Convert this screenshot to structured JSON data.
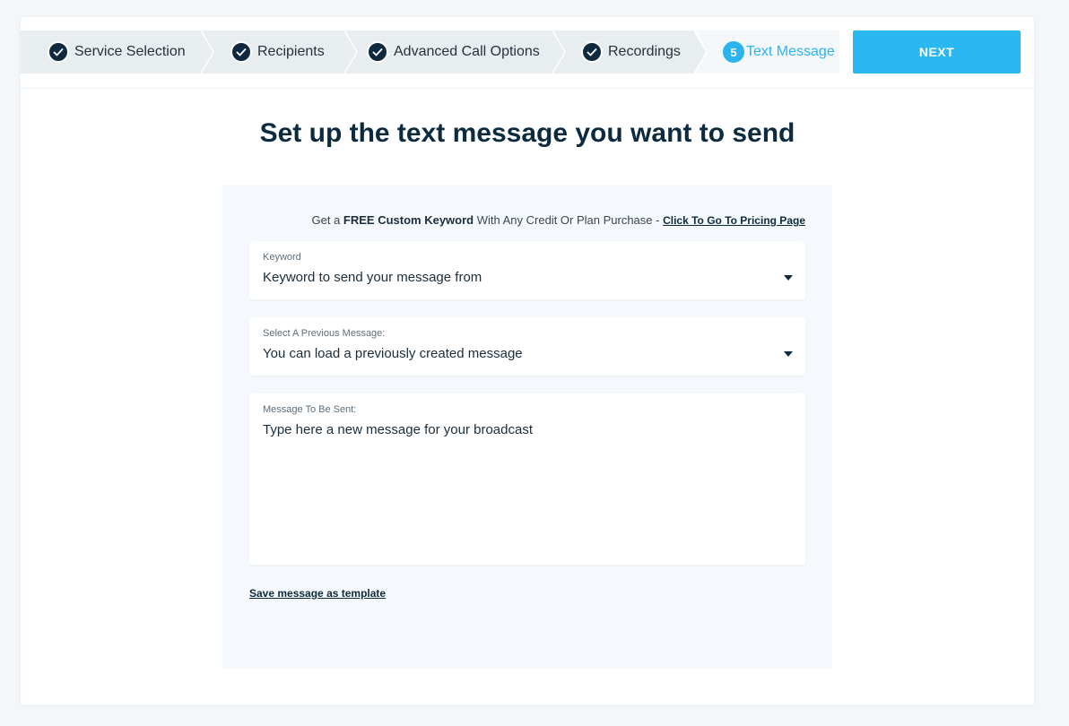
{
  "steps": [
    {
      "label": "Service Selection",
      "status": "done"
    },
    {
      "label": "Recipients",
      "status": "done"
    },
    {
      "label": "Advanced Call Options",
      "status": "done"
    },
    {
      "label": "Recordings",
      "status": "done"
    },
    {
      "label": "Text Message",
      "status": "active",
      "number": "5"
    }
  ],
  "next_button": "NEXT",
  "page_title": "Set up the text message you want to send",
  "promo": {
    "prefix": "Get a ",
    "bold": "FREE Custom Keyword",
    "suffix": " With Any Credit Or Plan Purchase - ",
    "link": "Click To Go To Pricing Page"
  },
  "keyword_field": {
    "label": "Keyword",
    "value": "Keyword to send your message from"
  },
  "previous_message_field": {
    "label": "Select A Previous Message:",
    "value": "You can load a previously created message"
  },
  "message_field": {
    "label": "Message To Be Sent:",
    "placeholder": "Type here a new message for your broadcast"
  },
  "save_template_link": "Save message as template",
  "colors": {
    "accent": "#2bb7f0",
    "navy": "#0f2a3f",
    "step_bar": "#e8edf0",
    "panel": "#f5f8fc"
  }
}
